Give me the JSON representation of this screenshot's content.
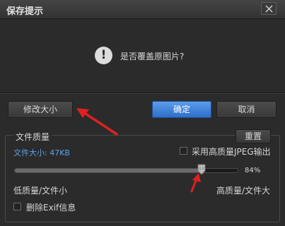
{
  "window": {
    "title": "保存提示",
    "close_icon": "close-icon"
  },
  "dialog": {
    "icon": "exclamation-icon",
    "icon_glyph": "!",
    "question": "是否覆盖原图片?"
  },
  "buttons": {
    "resize": "修改大小",
    "ok": "确定",
    "cancel": "取消",
    "reset": "重置"
  },
  "quality": {
    "group_title": "文件质量",
    "file_size": "文件大小: 47KB",
    "high_quality_jpeg_label": "采用高质量JPEG输出",
    "high_quality_jpeg_checked": false,
    "slider_fraction": 0.84,
    "slider_value": "84%",
    "low_label": "低质量/文件小",
    "high_label": "高质量/文件大",
    "remove_exif_label": "删除Exif信息",
    "remove_exif_checked": false
  },
  "colors": {
    "accent": "#2d6fcb",
    "annotation_arrow": "#e02020",
    "file_size_text": "#5aa4e8"
  }
}
